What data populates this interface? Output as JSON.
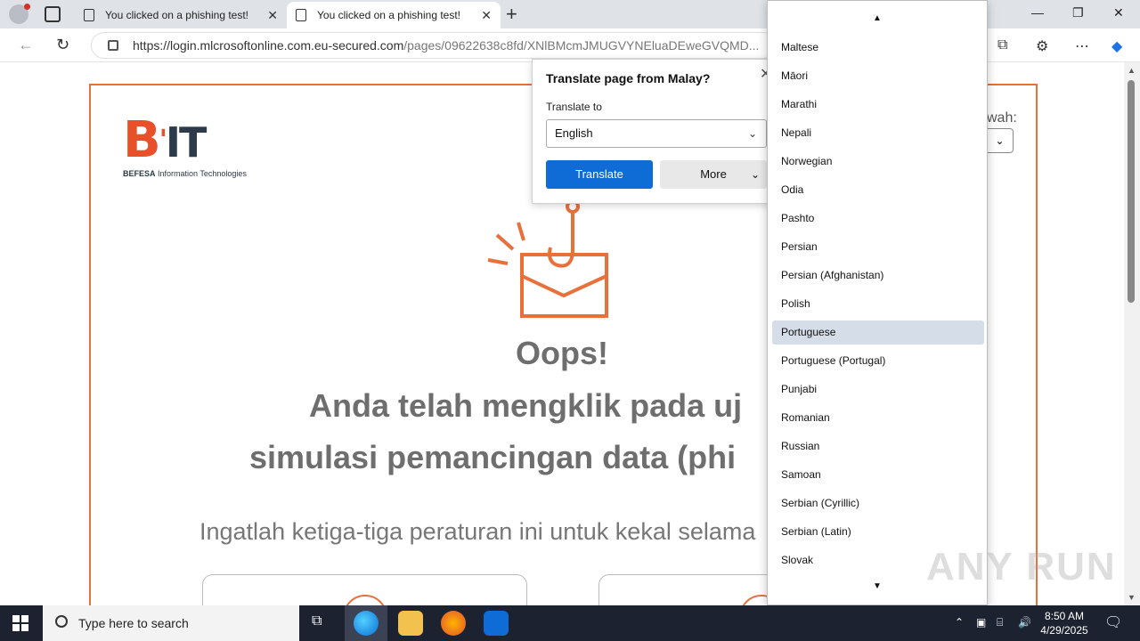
{
  "browser": {
    "tabs": [
      {
        "title": "You clicked on a phishing test!"
      },
      {
        "title": "You clicked on a phishing test!"
      }
    ],
    "url_main": "https://login.mlcrosoftonline.com.eu-secured.com",
    "url_rest": "/pages/09622638c8fd/XNlBMcmJMUGVYNEluaDEweGVQMD..."
  },
  "page": {
    "logo_small_bold": "BEFESA",
    "logo_small_rest": " Information Technologies",
    "lang_label": "wah:",
    "oops": "Oops!",
    "headline1": "Anda telah mengklik pada uj",
    "headline2": "simulasi pemancingan data (phi",
    "rules": "Ingatlah ketiga-tiga peraturan ini untuk kekal selama"
  },
  "translate_popup": {
    "title": "Translate page from Malay?",
    "translate_to_label": "Translate to",
    "selected_language": "English",
    "translate_button": "Translate",
    "more_button": "More"
  },
  "language_dropdown": {
    "selected": "Portuguese",
    "items": [
      "Maltese",
      "Māori",
      "Marathi",
      "Nepali",
      "Norwegian",
      "Odia",
      "Pashto",
      "Persian",
      "Persian (Afghanistan)",
      "Polish",
      "Portuguese",
      "Portuguese (Portugal)",
      "Punjabi",
      "Romanian",
      "Russian",
      "Samoan",
      "Serbian (Cyrillic)",
      "Serbian (Latin)",
      "Slovak"
    ]
  },
  "taskbar": {
    "search_placeholder": "Type here to search",
    "time": "8:50 AM",
    "date": "4/29/2025"
  },
  "watermark": "ANY RUN",
  "colors": {
    "accent_orange": "#e8703a",
    "translate_blue": "#0f6cd6",
    "dropdown_selected": "#d5dde8"
  }
}
